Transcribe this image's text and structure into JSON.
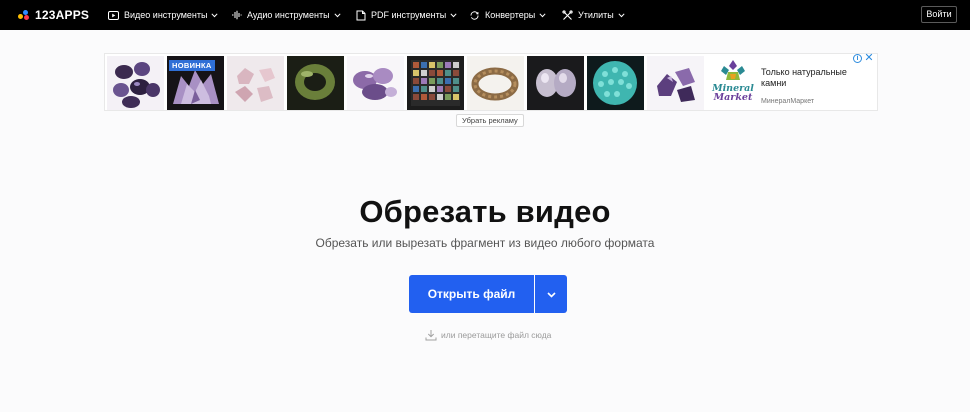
{
  "header": {
    "logo_text": "123APPS",
    "nav": [
      {
        "label": "Видео инструменты",
        "icon": "video-icon"
      },
      {
        "label": "Аудио инструменты",
        "icon": "audio-wave-icon"
      },
      {
        "label": "PDF инструменты",
        "icon": "pdf-icon"
      },
      {
        "label": "Конвертеры",
        "icon": "convert-icon"
      },
      {
        "label": "Утилиты",
        "icon": "tools-icon"
      }
    ],
    "login_label": "Войти"
  },
  "ad": {
    "badge": "НОВИНКА",
    "brand_line1": "Mineral",
    "brand_line2": "Market",
    "text": "Только натуральные камни",
    "advertiser": "МинералМаркет",
    "remove_label": "Убрать рекламу",
    "info_icon": "info-icon",
    "close_icon": "close-icon"
  },
  "main": {
    "title": "Обрезать видео",
    "subtitle": "Обрезать или вырезать фрагмент из видео любого формата",
    "open_button": "Открыть файл",
    "drag_hint": "или перетащите файл сюда"
  },
  "colors": {
    "header_bg": "#000000",
    "accent": "#2260f0",
    "page_bg": "#fbfbfc"
  }
}
